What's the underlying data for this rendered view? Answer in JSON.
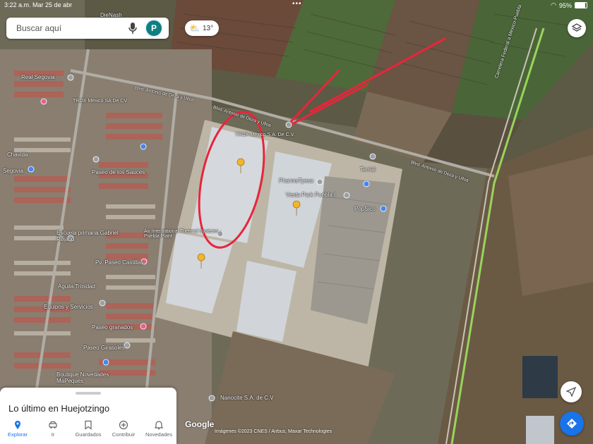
{
  "status_bar": {
    "time": "3:22 a.m.",
    "date": "Mar 25 de abr",
    "battery": "95%"
  },
  "search": {
    "placeholder": "Buscar aquí",
    "avatar_letter": "P"
  },
  "weather": {
    "temperature": "13°"
  },
  "bottom_sheet": {
    "title": "Lo último en Huejotzingo",
    "tabs": [
      {
        "label": "Explorar",
        "icon": "pin-icon"
      },
      {
        "label": "Ir",
        "icon": "car-icon"
      },
      {
        "label": "Guardados",
        "icon": "bookmark-icon"
      },
      {
        "label": "Contribuir",
        "icon": "plus-circle-icon"
      },
      {
        "label": "Novedades",
        "icon": "bell-icon"
      }
    ],
    "active_tab": "Explorar"
  },
  "map": {
    "attribution_logo": "Google",
    "credit": "Imágenes ©2023 CNES / Airbus, Maxar Technologies",
    "labels": {
      "dienash": "DieNash",
      "real_segovia": "Real Segovia",
      "trox_top": "TROX México SA De CV",
      "trox_main": "TROX México S.A. De C.V.",
      "blvd_left": "Blvd. Antonio de Deza y Ulloa",
      "blvd_mid": "Blvd. Antonio de Deza y Ulloa",
      "blvd_right": "Blvd. Antonio de Deza y Ulloa",
      "chavida": "Chavida",
      "segovia": "Segovia",
      "paseo_sauces": "Paseo de los Sauces",
      "pharmstyesa": "PharmsTyesa",
      "vesta": "Vesta Park Puebla I",
      "terrial": "Terrial",
      "popsico": "PopSico",
      "air_intl": "Air International Thermal Systems - Puebla Plant",
      "escuela": "Escuela primaria Gabriel Rojano",
      "paseo_castillas": "Pv. Paseo Castillas",
      "aguila": "Águila Trinidad",
      "equipos": "Equipos y Servicios",
      "paseo_granados": "Paseo granados",
      "paseo_girasoles": "Paseo Girasoles",
      "boutique": "Boutique Novedades MaPeques",
      "nanocite": "Nanocite S.A. de C.V",
      "carretera": "Carretera Federal a México-Puebla"
    }
  },
  "colors": {
    "accent": "#1a73e8",
    "annotation": "#e8253a",
    "avatar": "#0f7f80"
  }
}
